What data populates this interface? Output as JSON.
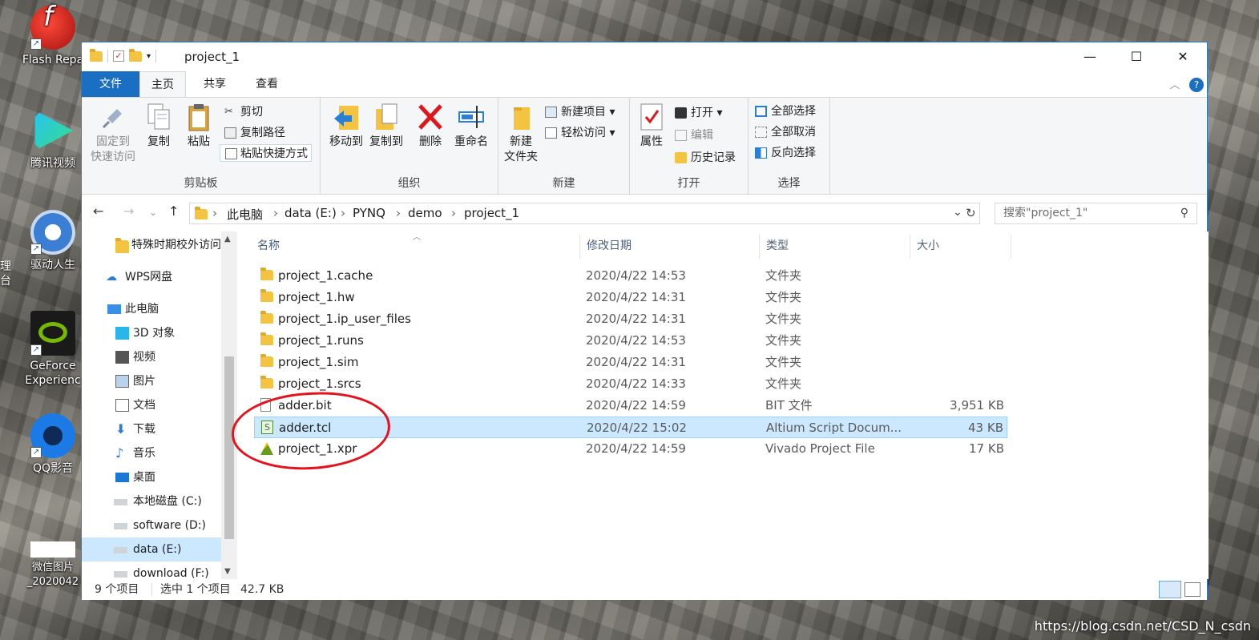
{
  "desktop": {
    "icons": [
      {
        "label": "Flash Repa",
        "color": "#c81e1e"
      },
      {
        "label": "腾讯视频",
        "color": "#1eb0f0"
      },
      {
        "label": "驱动人生",
        "color": "#4a88d8"
      },
      {
        "label": "GeForce\nExperienc",
        "color": "#76b900"
      },
      {
        "label": "QQ影音",
        "color": "#1b6fd6"
      },
      {
        "label": "微信图片_2020042",
        "color": "#ffffff"
      }
    ],
    "left_edge_labels": [
      "理",
      "台"
    ],
    "watermark": "https://blog.csdn.net/CSD_N_csdn"
  },
  "window": {
    "title": "project_1",
    "controls": {
      "minimize": "—",
      "maximize": "☐",
      "close": "✕"
    },
    "tabs": [
      "文件",
      "主页",
      "共享",
      "查看"
    ],
    "ribbon": {
      "clipboard": {
        "label": "剪贴板",
        "pin": "固定到\n快速访问",
        "copy": "复制",
        "paste": "粘贴",
        "cut": "剪切",
        "copy_path": "复制路径",
        "paste_shortcut": "粘贴快捷方式"
      },
      "organize": {
        "label": "组织",
        "move_to": "移动到",
        "copy_to": "复制到",
        "delete": "删除",
        "rename": "重命名"
      },
      "new": {
        "label": "新建",
        "new_folder": "新建\n文件夹",
        "new_item": "新建项目",
        "easy_access": "轻松访问"
      },
      "open": {
        "label": "打开",
        "properties": "属性",
        "open": "打开",
        "edit": "编辑",
        "history": "历史记录"
      },
      "select": {
        "label": "选择",
        "select_all": "全部选择",
        "select_none": "全部取消",
        "invert": "反向选择"
      }
    },
    "address": {
      "crumbs": [
        "此电脑",
        "data (E:)",
        "PYNQ",
        "demo",
        "project_1"
      ],
      "search_placeholder": "搜索\"project_1\""
    },
    "nav": [
      {
        "label": "特殊时期校外访问",
        "icon": "folder-icon"
      },
      {
        "label": "WPS网盘",
        "icon": "cloud-icon"
      },
      {
        "label": "此电脑",
        "icon": "computer-icon"
      },
      {
        "label": "3D 对象",
        "icon": "cube-icon"
      },
      {
        "label": "视频",
        "icon": "video-icon"
      },
      {
        "label": "图片",
        "icon": "picture-icon"
      },
      {
        "label": "文档",
        "icon": "document-icon"
      },
      {
        "label": "下载",
        "icon": "download-icon"
      },
      {
        "label": "音乐",
        "icon": "music-icon"
      },
      {
        "label": "桌面",
        "icon": "desktop-icon"
      },
      {
        "label": "本地磁盘 (C:)",
        "icon": "drive-icon"
      },
      {
        "label": "software (D:)",
        "icon": "drive-icon"
      },
      {
        "label": "data (E:)",
        "icon": "drive-icon",
        "selected": true
      },
      {
        "label": "download (F:)",
        "icon": "drive-icon"
      }
    ],
    "columns": [
      "名称",
      "修改日期",
      "类型",
      "大小"
    ],
    "files": [
      {
        "name": "project_1.cache",
        "date": "2020/4/22 14:53",
        "type": "文件夹",
        "size": "",
        "icon": "folder-icon"
      },
      {
        "name": "project_1.hw",
        "date": "2020/4/22 14:31",
        "type": "文件夹",
        "size": "",
        "icon": "folder-icon"
      },
      {
        "name": "project_1.ip_user_files",
        "date": "2020/4/22 14:31",
        "type": "文件夹",
        "size": "",
        "icon": "folder-icon"
      },
      {
        "name": "project_1.runs",
        "date": "2020/4/22 14:53",
        "type": "文件夹",
        "size": "",
        "icon": "folder-icon"
      },
      {
        "name": "project_1.sim",
        "date": "2020/4/22 14:31",
        "type": "文件夹",
        "size": "",
        "icon": "folder-icon"
      },
      {
        "name": "project_1.srcs",
        "date": "2020/4/22 14:33",
        "type": "文件夹",
        "size": "",
        "icon": "folder-icon"
      },
      {
        "name": "adder.bit",
        "date": "2020/4/22 14:59",
        "type": "BIT 文件",
        "size": "3,951 KB",
        "icon": "file-icon"
      },
      {
        "name": "adder.tcl",
        "date": "2020/4/22 15:02",
        "type": "Altium Script Docum...",
        "size": "43 KB",
        "icon": "script-icon",
        "selected": true
      },
      {
        "name": "project_1.xpr",
        "date": "2020/4/22 14:59",
        "type": "Vivado Project File",
        "size": "17 KB",
        "icon": "vivado-icon"
      }
    ],
    "status": {
      "count": "9 个项目",
      "selection": "选中 1 个项目",
      "size": "42.7 KB"
    }
  }
}
